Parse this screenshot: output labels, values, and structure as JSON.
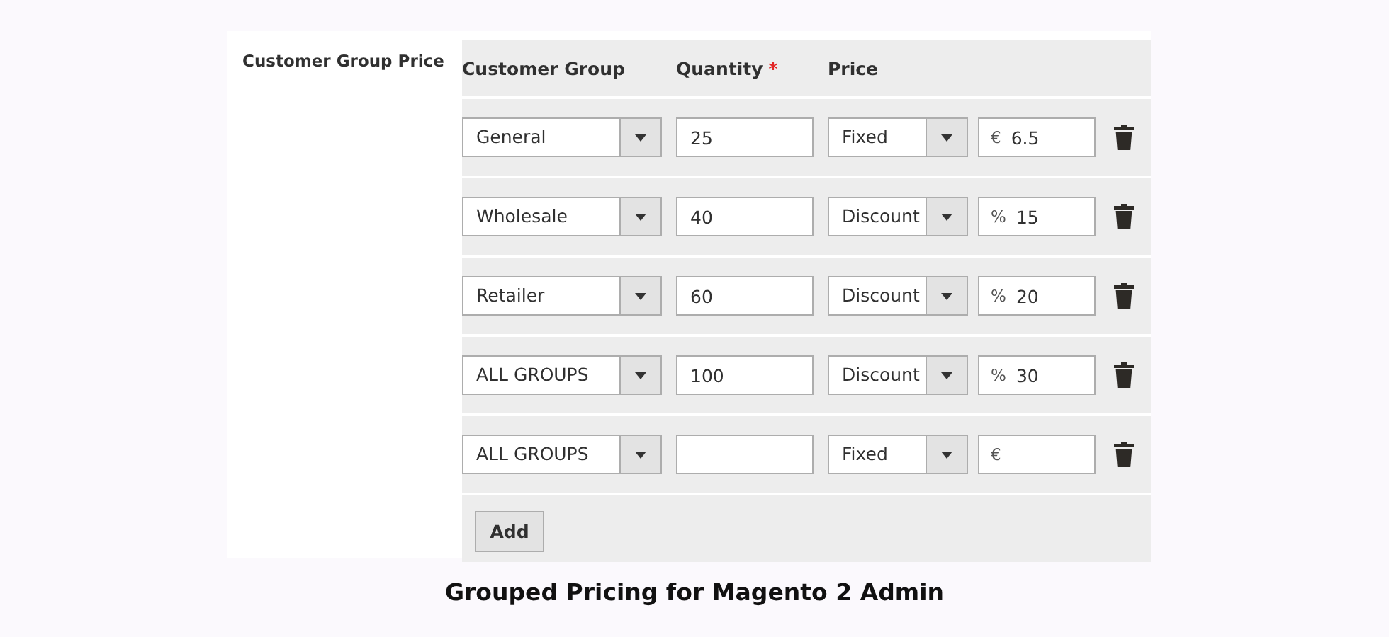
{
  "field_label": "Customer Group Price",
  "columns": [
    {
      "label": "Customer Group"
    },
    {
      "label": "Quantity",
      "required_mark": "*"
    },
    {
      "label": "Price"
    }
  ],
  "rows": [
    {
      "group": "General",
      "quantity": "25",
      "price_type": "Fixed",
      "currency": "€",
      "value": "6.5"
    },
    {
      "group": "Wholesale",
      "quantity": "40",
      "price_type": "Discount",
      "currency": "%",
      "value": "15"
    },
    {
      "group": "Retailer",
      "quantity": "60",
      "price_type": "Discount",
      "currency": "%",
      "value": "20"
    },
    {
      "group": "ALL GROUPS",
      "quantity": "100",
      "price_type": "Discount",
      "currency": "%",
      "value": "30"
    },
    {
      "group": "ALL GROUPS",
      "price_type": "Fixed",
      "currency": "€"
    }
  ],
  "add_button": "Add",
  "caption": "Grouped Pricing for Magento 2 Admin"
}
